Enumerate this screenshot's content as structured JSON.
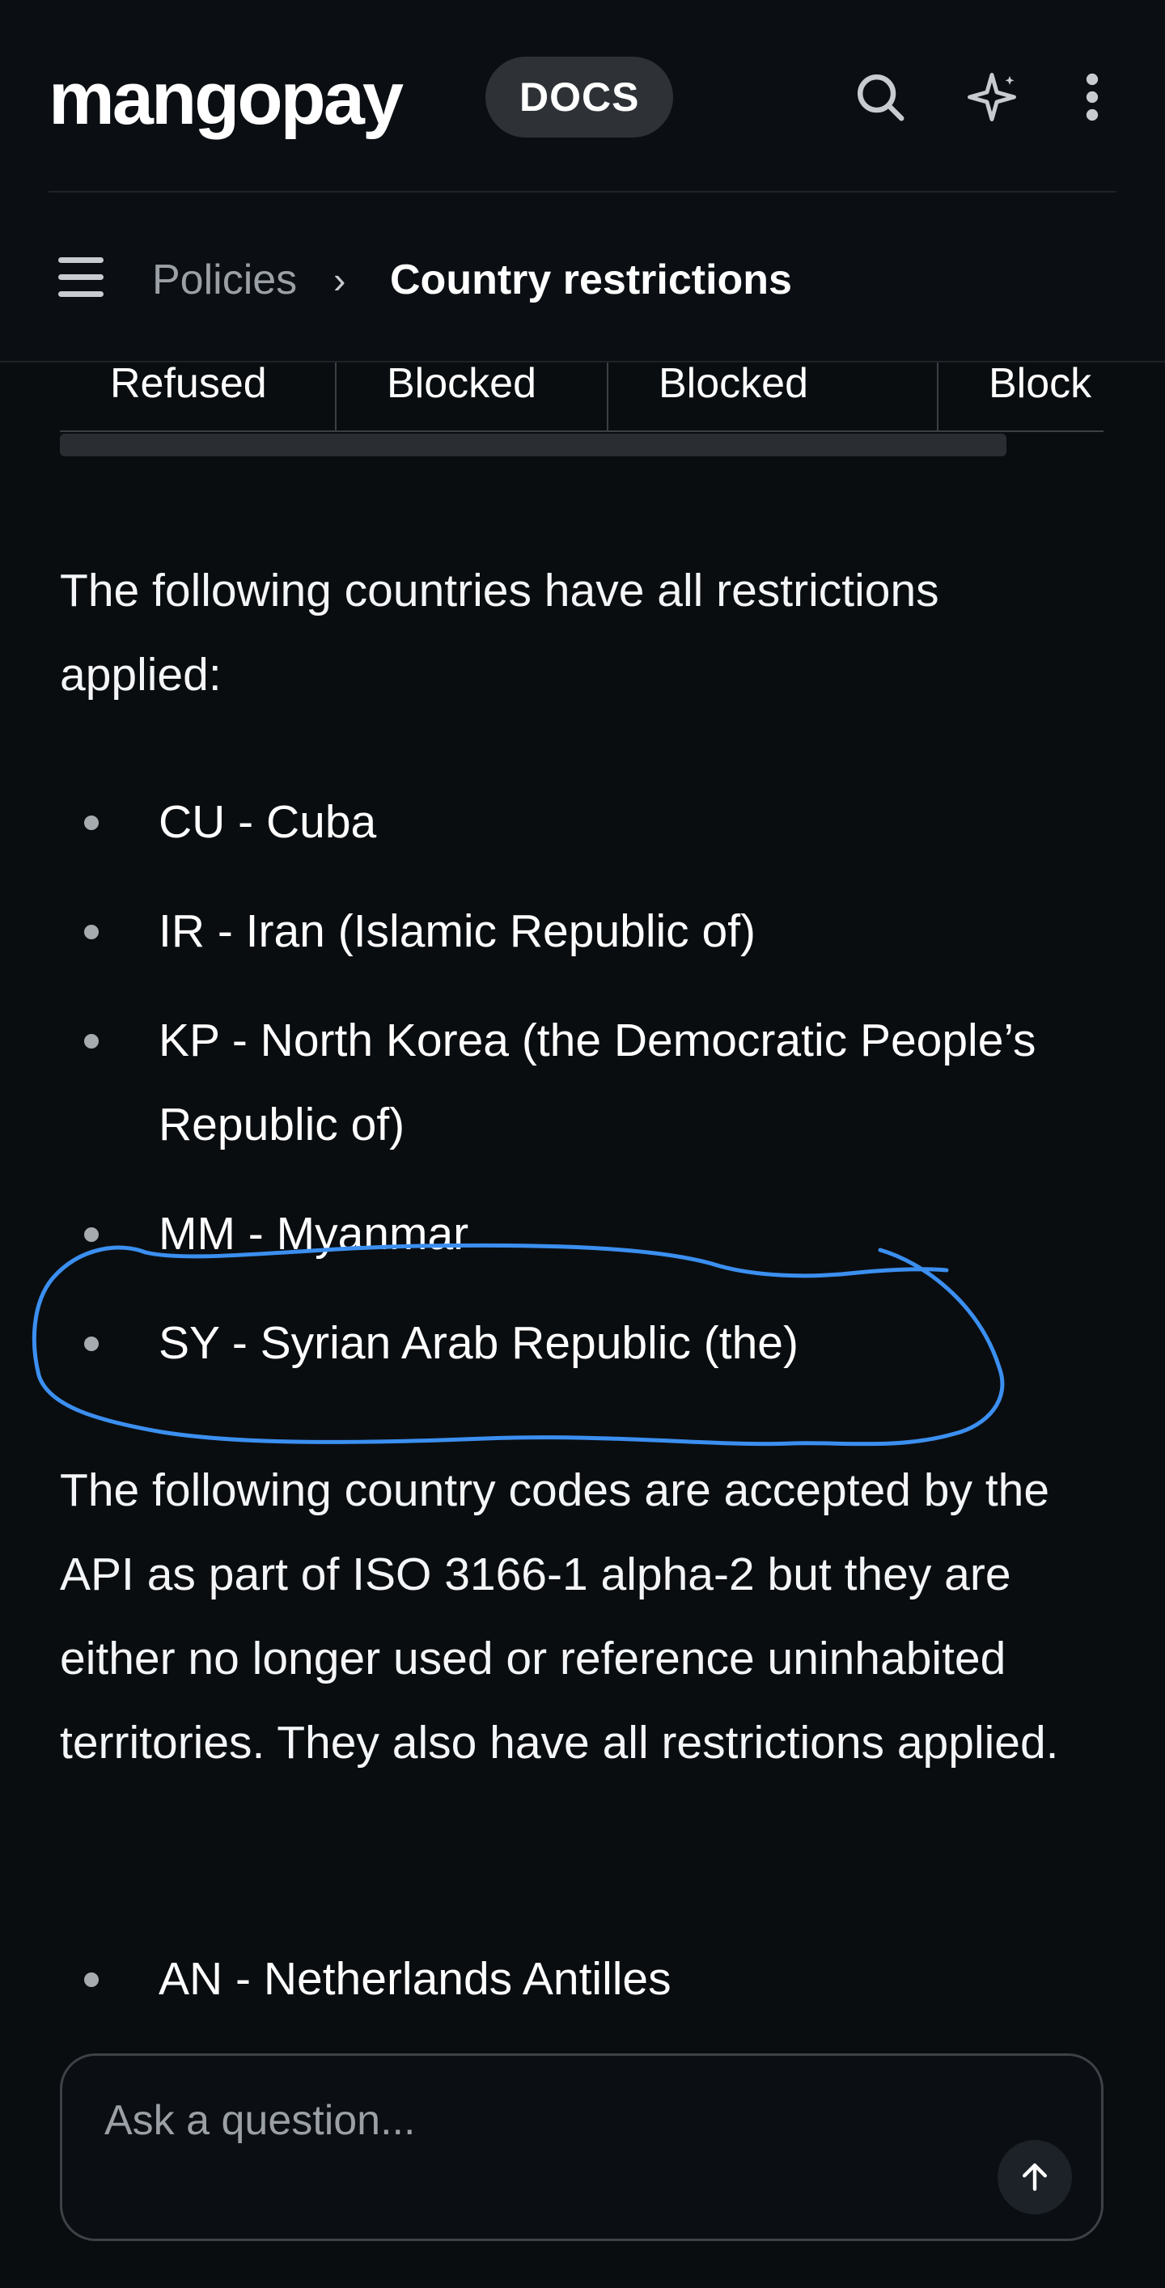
{
  "header": {
    "logo_text": "mangopay",
    "badge_label": "DOCS",
    "icons": [
      "search-icon",
      "sparkle-icon",
      "more-vertical-icon"
    ]
  },
  "breadcrumb": {
    "menu_icon": "hamburger-menu-icon",
    "parent": "Policies",
    "separator": "›",
    "current": "Country restrictions"
  },
  "table_fragment": {
    "cells": [
      "Refused",
      "Blocked",
      "Blocked",
      "Block"
    ]
  },
  "content": {
    "intro": "The following countries have all restrictions applied:",
    "restricted_countries": [
      "CU - Cuba",
      "IR - Iran (Islamic Republic of)",
      "KP - North Korea (the Democratic People’s Republic of)",
      "MM - Myanmar",
      "SY - Syrian Arab Republic (the)"
    ],
    "codes_paragraph": "The following country codes are accepted by the API as part of ISO 3166-1 alpha-2 but they are either no longer used or reference uninhabited territories. They also have all restrictions applied.",
    "inactive_codes": [
      "AN - Netherlands Antilles"
    ]
  },
  "ask": {
    "placeholder": "Ask a question...",
    "send_icon": "arrow-up-icon"
  },
  "colors": {
    "background": "#0a0d10",
    "text": "#ffffff",
    "annotation": "#3b8ff0"
  }
}
